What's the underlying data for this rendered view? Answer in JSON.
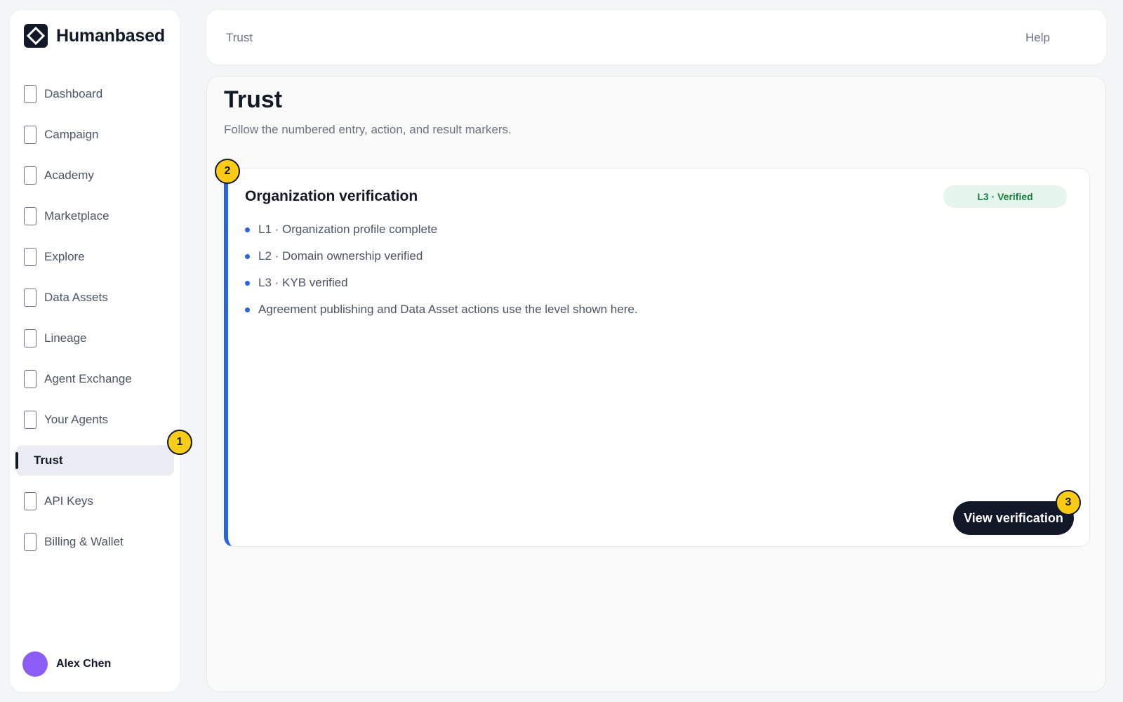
{
  "brand": {
    "name": "Humanbased",
    "logo_icon": "diamond-logo-icon"
  },
  "sidebar": {
    "items": [
      {
        "label": "Dashboard",
        "icon": "page-icon",
        "active": false
      },
      {
        "label": "Campaign",
        "icon": "page-icon",
        "active": false
      },
      {
        "label": "Academy",
        "icon": "page-icon",
        "active": false
      },
      {
        "label": "Marketplace",
        "icon": "page-icon",
        "active": false
      },
      {
        "label": "Explore",
        "icon": "page-icon",
        "active": false
      },
      {
        "label": "Data Assets",
        "icon": "page-icon",
        "active": false
      },
      {
        "label": "Lineage",
        "icon": "page-icon",
        "active": false
      },
      {
        "label": "Agent Exchange",
        "icon": "page-icon",
        "active": false
      },
      {
        "label": "Your Agents",
        "icon": "page-icon",
        "active": false
      },
      {
        "label": "Trust",
        "icon": "",
        "active": true
      },
      {
        "label": "API Keys",
        "icon": "page-icon",
        "active": false
      },
      {
        "label": "Billing & Wallet",
        "icon": "page-icon",
        "active": false
      }
    ],
    "user": {
      "name": "Alex Chen",
      "avatar_color": "#8b5cf6"
    }
  },
  "topbar": {
    "title": "Trust",
    "help": "Help"
  },
  "main": {
    "title": "Trust",
    "subtitle": "Follow the numbered entry, action, and result markers."
  },
  "card": {
    "title": "Organization verification",
    "status": "L3 · Verified",
    "bullets": [
      "L1 · Organization profile complete",
      "L2 · Domain ownership verified",
      "L3 · KYB verified",
      "Agreement publishing and Data Asset actions use the level shown here."
    ],
    "cta_label": "View verification"
  },
  "markers": {
    "entry": "1",
    "action": "2",
    "result": "3"
  },
  "colors": {
    "accent": "#2563eb",
    "marker": "#facc15",
    "dark": "#111827",
    "success_bg": "#e6f6ec",
    "success_text": "#15803d"
  }
}
